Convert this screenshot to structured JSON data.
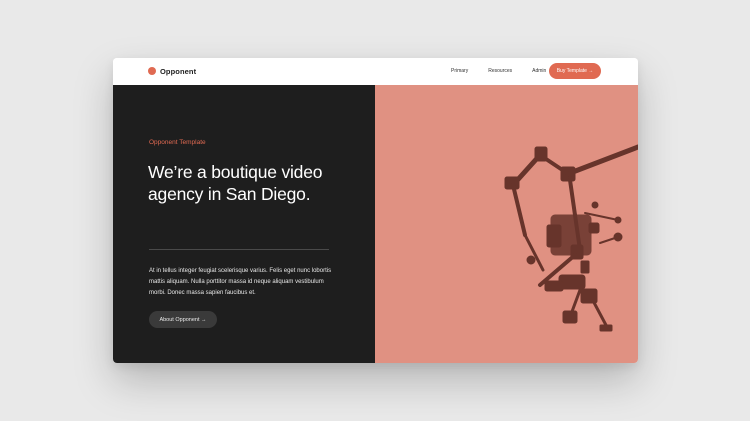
{
  "navbar": {
    "brand_name": "Opponent",
    "links": [
      "Primary",
      "Resources",
      "Admin"
    ],
    "cta_label": "Buy Template →"
  },
  "hero": {
    "eyebrow": "Opponent Template",
    "headline": "We’re a boutique video agency in San Diego.",
    "body": "At in tellus integer feugiat scelerisque varius. Felis eget nunc lobortis mattis aliquam. Nulla porttitor massa id neque aliquam vestibulum morbi. Donec massa sapien faucibus et.",
    "button_label": "About Opponent →"
  },
  "image": {
    "subject": "camera-rig-image"
  },
  "colors": {
    "accent": "#e06a52",
    "dark_panel": "#1e1e1e",
    "image_tint": "#e09182",
    "page_bg": "#e9e9e9"
  }
}
